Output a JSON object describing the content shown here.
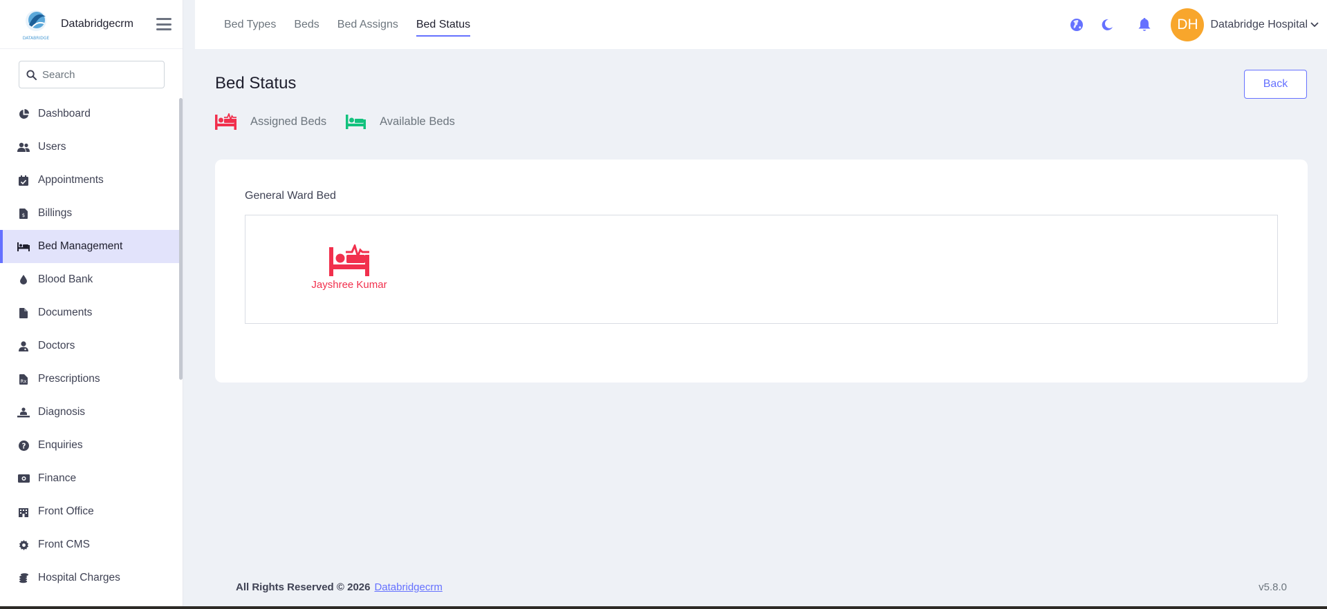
{
  "brand": {
    "name": "Databridgecrm",
    "logo_text": "DATABRIDGE"
  },
  "search": {
    "placeholder": "Search"
  },
  "sidebar": {
    "items": [
      {
        "label": "Dashboard",
        "icon": "pie-chart-icon"
      },
      {
        "label": "Users",
        "icon": "users-icon"
      },
      {
        "label": "Appointments",
        "icon": "calendar-check-icon"
      },
      {
        "label": "Billings",
        "icon": "invoice-icon"
      },
      {
        "label": "Bed Management",
        "icon": "bed-icon",
        "active": true
      },
      {
        "label": "Blood Bank",
        "icon": "droplet-icon"
      },
      {
        "label": "Documents",
        "icon": "file-icon"
      },
      {
        "label": "Doctors",
        "icon": "user-doctor-icon"
      },
      {
        "label": "Prescriptions",
        "icon": "prescription-icon"
      },
      {
        "label": "Diagnosis",
        "icon": "diagnosis-icon"
      },
      {
        "label": "Enquiries",
        "icon": "question-icon"
      },
      {
        "label": "Finance",
        "icon": "money-icon"
      },
      {
        "label": "Front Office",
        "icon": "building-icon"
      },
      {
        "label": "Front CMS",
        "icon": "gear-icon"
      },
      {
        "label": "Hospital Charges",
        "icon": "coins-icon"
      }
    ]
  },
  "header": {
    "tabs": [
      {
        "label": "Bed Types"
      },
      {
        "label": "Beds"
      },
      {
        "label": "Bed Assigns"
      },
      {
        "label": "Bed Status",
        "active": true
      }
    ],
    "avatar_initials": "DH",
    "user_name": "Databridge Hospital"
  },
  "page": {
    "title": "Bed Status",
    "back_label": "Back",
    "legend": {
      "assigned": "Assigned Beds",
      "available": "Available Beds"
    },
    "ward": {
      "title": "General Ward Bed",
      "beds": [
        {
          "patient": "Jayshree Kumar",
          "status": "assigned"
        }
      ]
    }
  },
  "footer": {
    "copyright": "All Rights Reserved © 2026",
    "link": "Databridgecrm",
    "version": "v5.8.0"
  },
  "colors": {
    "accent": "#6571ff",
    "assigned": "#f1304d",
    "available": "#13c27e",
    "avatar": "#f8a62c",
    "background": "#eef1f6"
  }
}
